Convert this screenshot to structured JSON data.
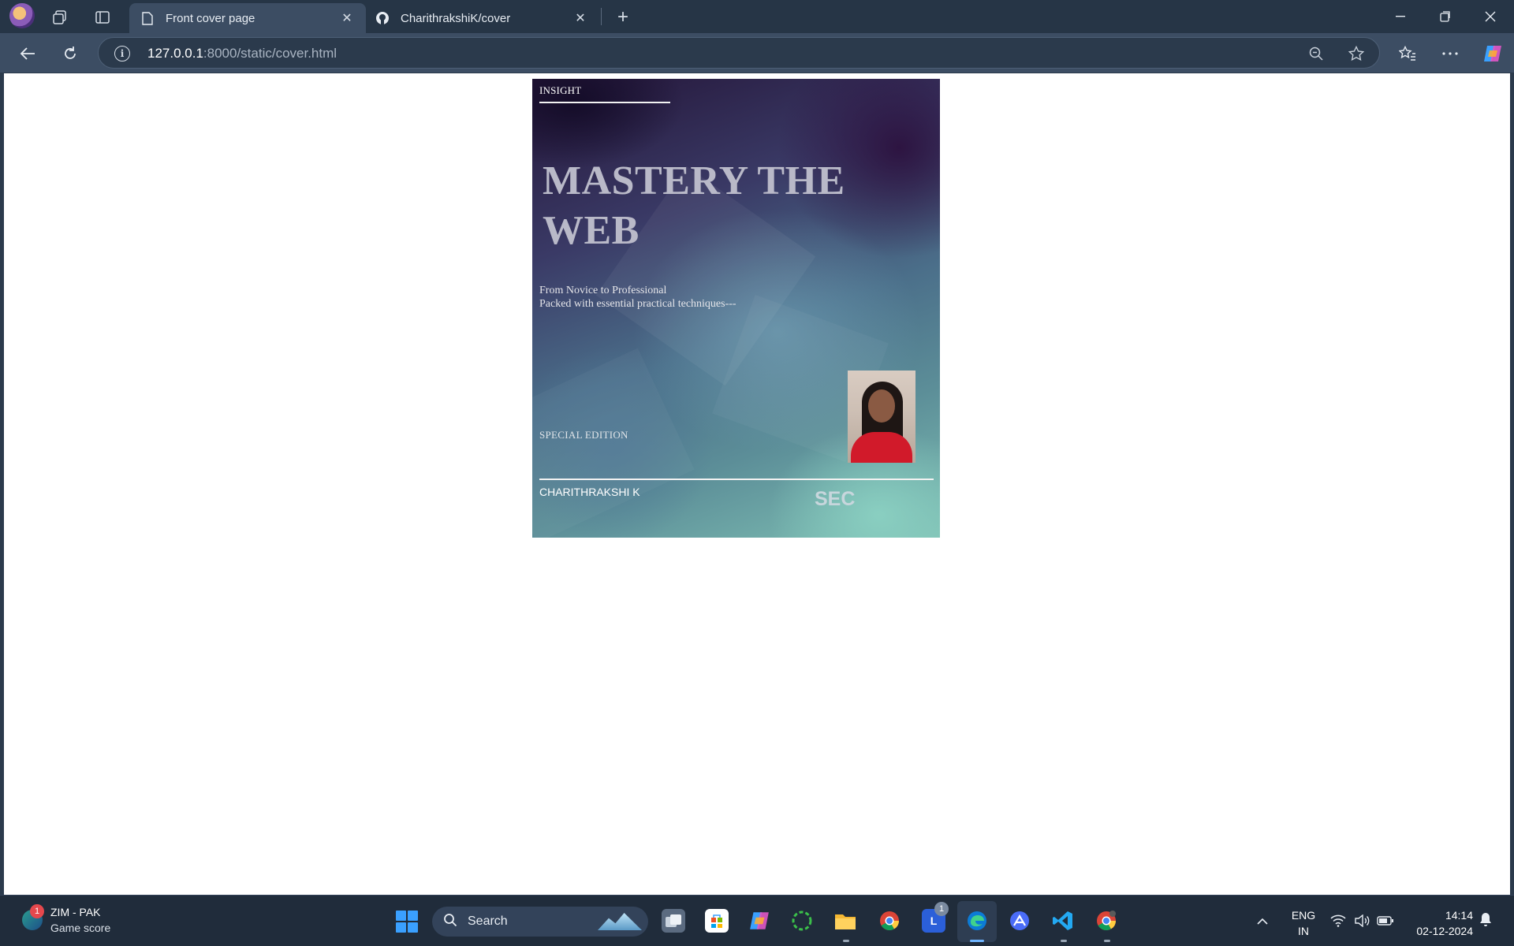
{
  "browser": {
    "tabs": [
      {
        "title": "Front cover page",
        "icon": "page-icon",
        "active": true
      },
      {
        "title": "CharithrakshiK/cover",
        "icon": "github-icon",
        "active": false
      }
    ],
    "new_tab_glyph": "+",
    "close_glyph": "✕",
    "address": {
      "host": "127.0.0.1",
      "path": ":8000/static/cover.html"
    }
  },
  "cover": {
    "publisher": "INSIGHT",
    "title": "MASTERY THE WEB",
    "subtitle_line1": "From Novice to Professional",
    "subtitle_line2": "Packed with essential practical techniques---",
    "edition": "SPECIAL EDITION",
    "author": "CHARITHRAKSHI K",
    "imprint": "SEC"
  },
  "taskbar": {
    "weather": {
      "line1": "ZIM - PAK",
      "line2": "Game score",
      "badge": "1"
    },
    "search_label": "Search",
    "apps": [
      "task-view",
      "microsoft-store",
      "copilot",
      "circle-app",
      "file-explorer",
      "chrome",
      "launcher-l",
      "edge",
      "arc-app",
      "vscode",
      "chrome-alt"
    ],
    "app_badge": "1",
    "language": {
      "line1": "ENG",
      "line2": "IN"
    },
    "clock": {
      "time": "14:14",
      "date": "02-12-2024"
    }
  },
  "colors": {
    "chrome_dark": "#263546",
    "chrome_mid": "#3c4d63",
    "cover_title": "#b9b9c8",
    "accent_blue": "#3aa0ff"
  }
}
